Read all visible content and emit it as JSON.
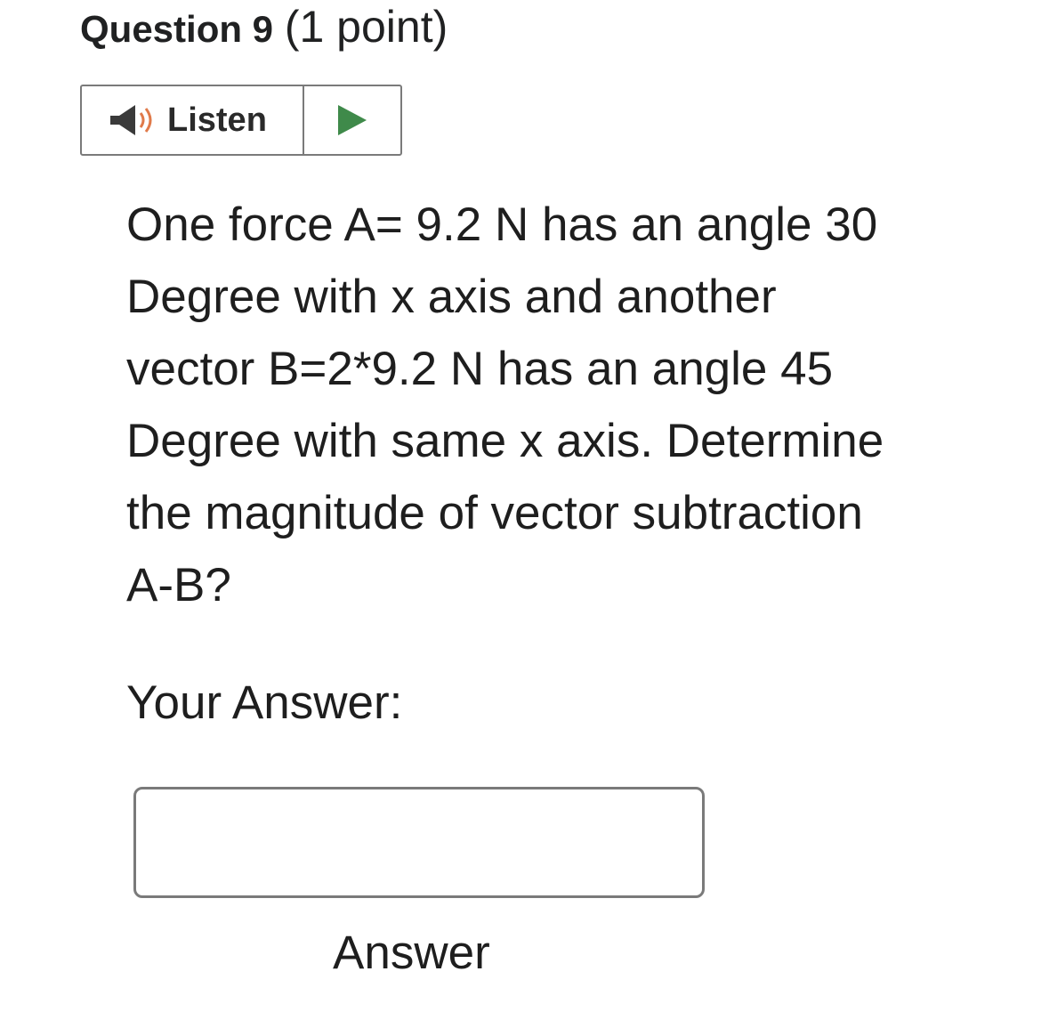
{
  "question": {
    "title": "Question 9",
    "points": "(1 point)",
    "lines": [
      "One force A= 9.2 N has an angle 30",
      "Degree with x axis and another",
      "vector B=2*9.2 N has an angle 45",
      "Degree with same x axis. Determine",
      "the magnitude of vector subtraction",
      "A-B?"
    ]
  },
  "listen": {
    "label": "Listen",
    "speaker_icon": "speaker-icon",
    "play_icon": "play-icon"
  },
  "answer": {
    "prompt": "Your Answer:",
    "value": "",
    "caption": "Answer"
  },
  "colors": {
    "play": "#3f8a4a",
    "speaker_waves": "#e07a4a",
    "speaker_body": "#3a3a3a",
    "border": "#7a7a7a"
  }
}
